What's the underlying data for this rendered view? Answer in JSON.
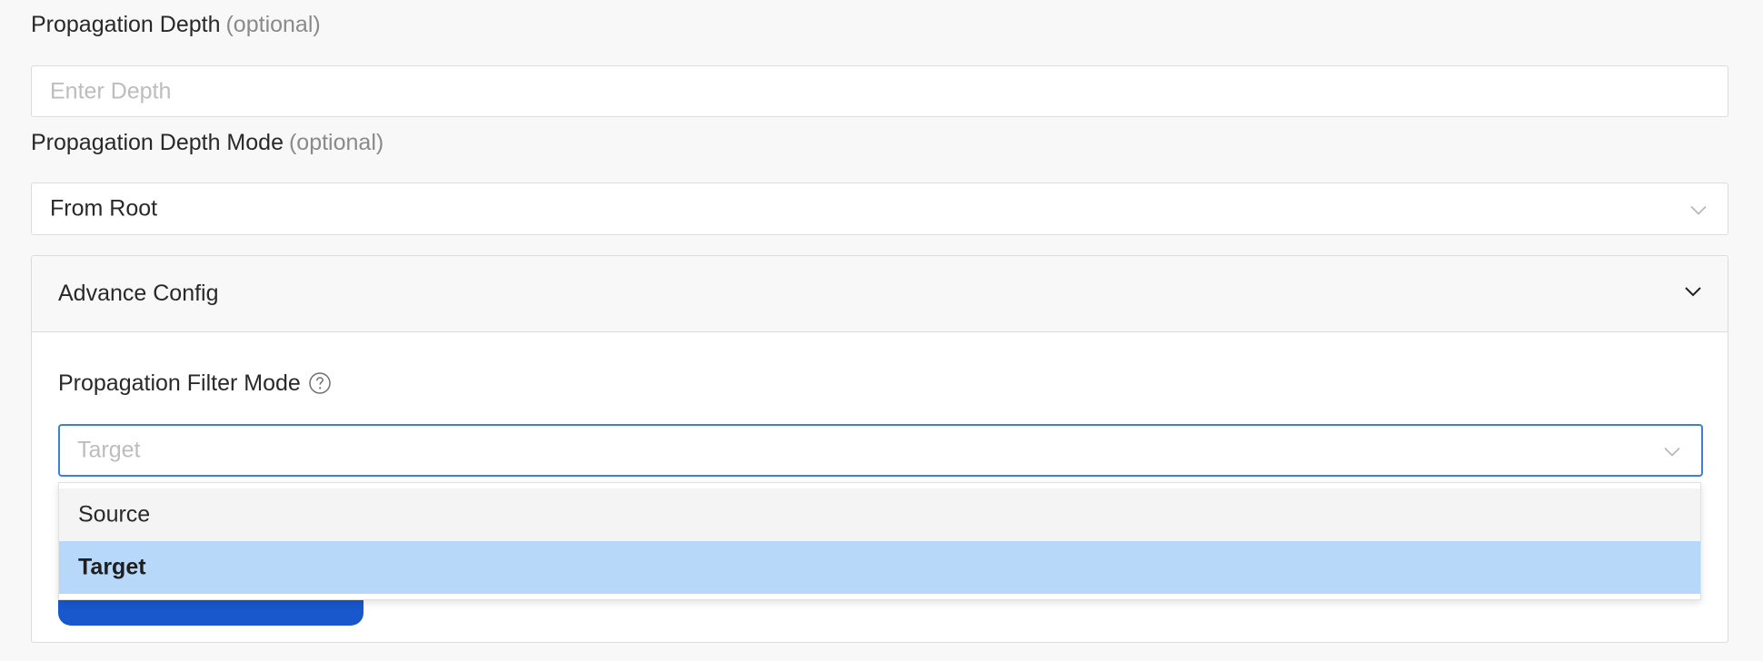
{
  "depth": {
    "label": "Propagation Depth",
    "optional": "(optional)",
    "placeholder": "Enter Depth"
  },
  "depth_mode": {
    "label": "Propagation Depth Mode",
    "optional": "(optional)",
    "value": "From Root"
  },
  "advance_config": {
    "title": "Advance Config",
    "filter_mode": {
      "label": "Propagation Filter Mode",
      "placeholder": "Target",
      "options": [
        "Source",
        "Target"
      ],
      "selected": "Target"
    }
  },
  "colors": {
    "focus_border": "#3d7fd9",
    "selected_option_bg": "#b8d8fa",
    "primary_button": "#1857cc"
  }
}
